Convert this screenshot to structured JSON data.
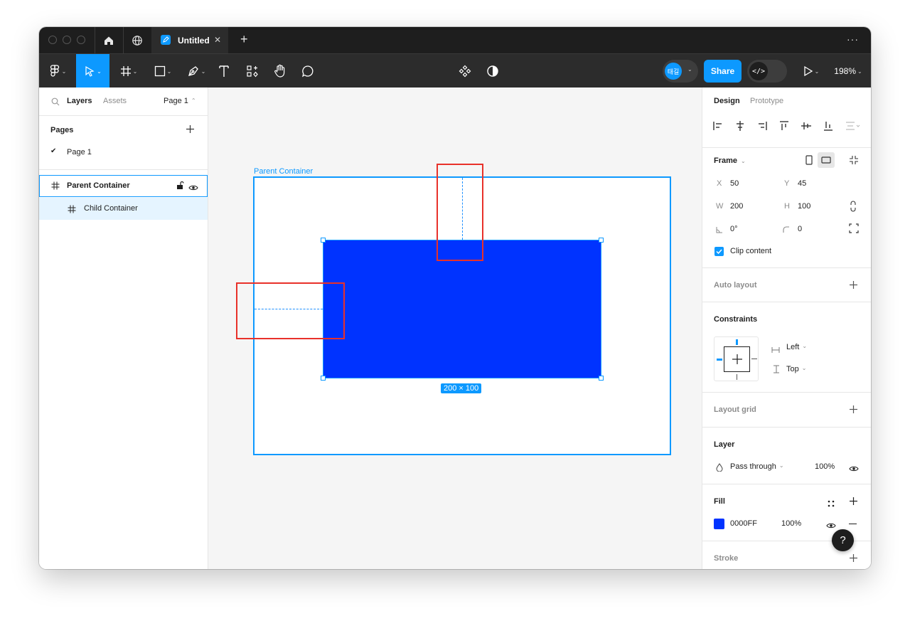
{
  "tabbar": {
    "file_tab_title": "Untitled",
    "close_glyph": "✕",
    "add_glyph": "+",
    "more_glyph": "···"
  },
  "toolbar": {
    "avatar_text": "태길",
    "share_label": "Share",
    "zoom_level": "198%",
    "code_glyph": "</>"
  },
  "left_panel": {
    "tabs": [
      "Layers",
      "Assets"
    ],
    "page_selector": "Page 1",
    "pages_heading": "Pages",
    "pages": [
      {
        "name": "Page 1",
        "selected": true
      }
    ],
    "layers": [
      {
        "name": "Parent Container",
        "selected": true
      },
      {
        "name": "Child Container",
        "selected": false
      }
    ]
  },
  "canvas": {
    "parent_frame_label": "Parent Container",
    "size_badge": "200 × 100",
    "child_fill": "#0033FF",
    "selection_color": "#0D99FF",
    "highlight_color": "#E8312A"
  },
  "right_panel": {
    "tabs": [
      "Design",
      "Prototype"
    ],
    "frame": {
      "title": "Frame",
      "x_label": "X",
      "x": "50",
      "y_label": "Y",
      "y": "45",
      "w_label": "W",
      "w": "200",
      "h_label": "H",
      "h": "100",
      "rotation": "0°",
      "radius": "0",
      "clip_content_label": "Clip content",
      "clip_content": true
    },
    "auto_layout": "Auto layout",
    "constraints": {
      "title": "Constraints",
      "horizontal": "Left",
      "vertical": "Top"
    },
    "layout_grid": "Layout grid",
    "layer": {
      "title": "Layer",
      "blend_mode": "Pass through",
      "opacity": "100%"
    },
    "fill": {
      "title": "Fill",
      "hex": "0000FF",
      "opacity": "100%",
      "swatch_color": "#0033FF"
    },
    "stroke": "Stroke",
    "help_glyph": "?"
  }
}
